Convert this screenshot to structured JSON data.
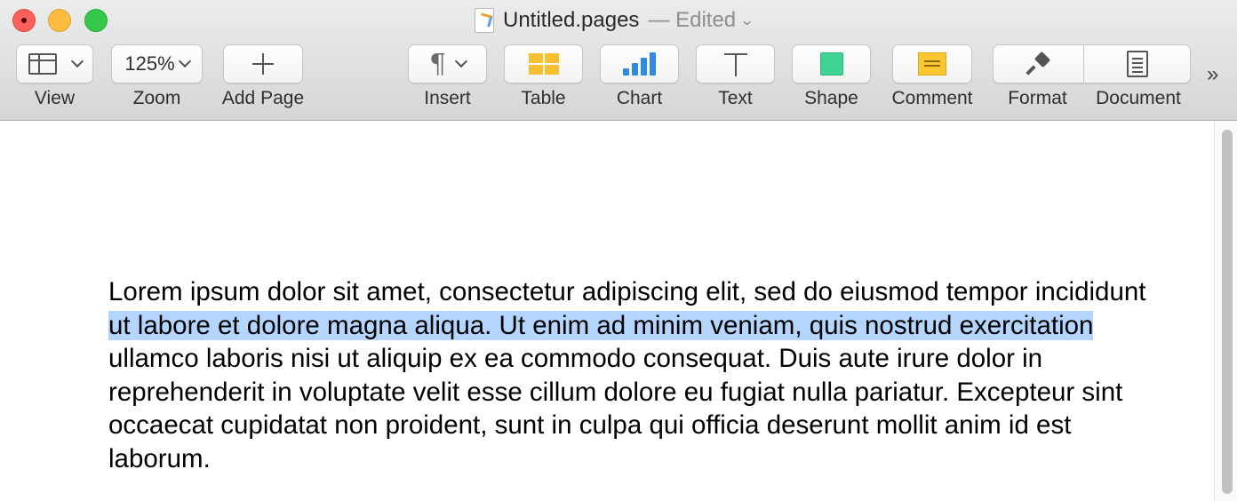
{
  "window": {
    "title": "Untitled.pages",
    "status": "— Edited",
    "chevron": "⌄"
  },
  "toolbar": {
    "view_label": "View",
    "zoom_value": "125%",
    "zoom_label": "Zoom",
    "add_page_label": "Add Page",
    "insert_label": "Insert",
    "insert_glyph": "¶",
    "table_label": "Table",
    "chart_label": "Chart",
    "text_label": "Text",
    "shape_label": "Shape",
    "comment_label": "Comment",
    "format_label": "Format",
    "document_label": "Document",
    "overflow_glyph": "»"
  },
  "document": {
    "text_before": "Lorem ipsum dolor sit amet, consectetur adipiscing elit, sed do eiusmod tempor incididunt ",
    "text_selected": "ut labore et dolore magna aliqua. Ut enim ad minim veniam, quis nostrud exercitation",
    "text_after": " ullamco laboris nisi ut aliquip ex ea commodo consequat. Duis aute irure dolor in reprehenderit in voluptate velit esse cillum dolore eu fugiat nulla pariatur. Excepteur sint occaecat cupidatat non proident, sunt in culpa qui officia deserunt mollit anim id est laborum."
  },
  "colors": {
    "selection": "#b4d5fe",
    "close": "#fc605c",
    "minimize": "#fdbc40",
    "zoom": "#34c84a",
    "table_icon": "#f6c131",
    "chart_icon": "#2f8ae6",
    "shape_icon": "#3fd495",
    "comment_icon": "#fbc62f"
  }
}
